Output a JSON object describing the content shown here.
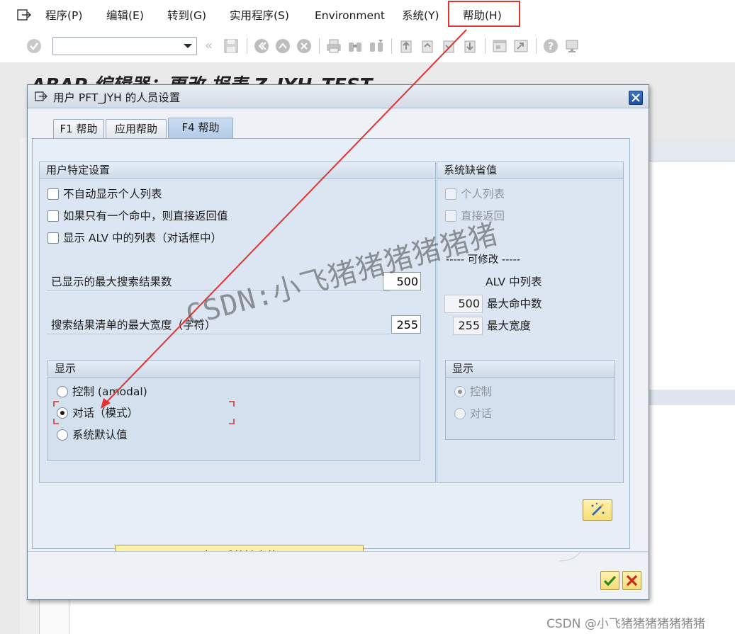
{
  "menubar": {
    "items": [
      {
        "label": "程序(P)",
        "name": "menu-program"
      },
      {
        "label": "编辑(E)",
        "name": "menu-edit"
      },
      {
        "label": "转到(G)",
        "name": "menu-goto"
      },
      {
        "label": "实用程序(S)",
        "name": "menu-utilities"
      },
      {
        "label": "Environment",
        "name": "menu-environment"
      },
      {
        "label": "系统(Y)",
        "name": "menu-system"
      },
      {
        "label": "帮助(H)",
        "name": "menu-help"
      }
    ]
  },
  "toolbar": {
    "command_value": "",
    "icons": [
      "check-icon",
      "back-double-icon",
      "save-icon",
      "back-icon",
      "exit-icon",
      "cancel-icon",
      "print-icon",
      "find-icon",
      "find-next-icon",
      "first-page-icon",
      "prev-page-icon",
      "next-page-icon",
      "last-page-icon",
      "new-session-icon",
      "shortcut-icon",
      "help-icon",
      "layout-icon"
    ]
  },
  "background": {
    "title": "ABAP 编辑器：更改 报表 Z_JYH_TEST"
  },
  "dialog": {
    "title": "用户 PFT_JYH 的人员设置",
    "tabs": [
      {
        "label": "F1 帮助",
        "active": false
      },
      {
        "label": "应用帮助",
        "active": false
      },
      {
        "label": "F4 帮助",
        "active": true
      }
    ],
    "user_settings": {
      "header": "用户特定设置",
      "checkboxes": [
        {
          "label": "不自动显示个人列表",
          "checked": false
        },
        {
          "label": "如果只有一个命中，则直接返回值",
          "checked": false
        },
        {
          "label": "显示 ALV 中的列表（对话框中）",
          "checked": false
        }
      ],
      "max_hits_label": "已显示的最大搜索结果数",
      "max_hits_value": "500",
      "max_width_label": "搜索结果清单的最大宽度（字符）",
      "max_width_value": "255",
      "display": {
        "header": "显示",
        "options": [
          {
            "label": "控制 (amodal)",
            "selected": false
          },
          {
            "label": "对话（模式）",
            "selected": true
          },
          {
            "label": "系统默认值",
            "selected": false
          }
        ]
      }
    },
    "system_defaults": {
      "header": "系统缺省值",
      "checkboxes": [
        {
          "label": "个人列表",
          "checked": false
        },
        {
          "label": "直接返回",
          "checked": false
        }
      ],
      "modifiable_label": "----- 可修改 -----",
      "alv_list_label": "ALV 中列表",
      "max_hits_value": "500",
      "max_hits_label": "最大命中数",
      "max_width_value": "255",
      "max_width_label": "最大宽度",
      "display": {
        "header": "显示",
        "options": [
          {
            "label": "控制",
            "selected": true
          },
          {
            "label": "对话",
            "selected": false
          }
        ]
      }
    },
    "apply_defaults_label": "应用系统缺省值",
    "scroll_grip": ":::"
  },
  "annotation": {
    "color": "#e23232",
    "watermark": "CSDN:小飞猪猪猪猪猪猪",
    "footer_watermark": "CSDN @小飞猪猪猪猪猪猪猪"
  }
}
